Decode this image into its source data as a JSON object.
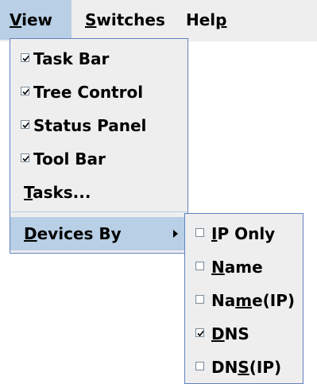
{
  "menubar": {
    "items": [
      {
        "mnemonic": "V",
        "rest": "iew"
      },
      {
        "mnemonic": "S",
        "rest": "witches"
      },
      {
        "pre": "Hel",
        "mnemonic": "p"
      }
    ]
  },
  "view_menu": {
    "items": [
      {
        "label": "Task Bar",
        "checked": true
      },
      {
        "label": "Tree Control",
        "checked": true
      },
      {
        "label": "Status Panel",
        "checked": true
      },
      {
        "label": "Tool Bar",
        "checked": true
      }
    ],
    "tasks": {
      "mnemonic": "T",
      "rest": "asks..."
    },
    "devices_by": {
      "mnemonic": "D",
      "rest": "evices By"
    }
  },
  "devices_submenu": {
    "items": [
      {
        "pre": "",
        "mnemonic": "I",
        "rest": "P Only",
        "checked": false
      },
      {
        "pre": "",
        "mnemonic": "N",
        "rest": "ame",
        "checked": false
      },
      {
        "pre": "Na",
        "mnemonic": "m",
        "rest": "e(IP)",
        "checked": false
      },
      {
        "pre": "",
        "mnemonic": "D",
        "rest": "NS",
        "checked": true
      },
      {
        "pre": "DN",
        "mnemonic": "S",
        "rest": "(IP)",
        "checked": false
      }
    ]
  },
  "colors": {
    "menu_bg": "#eeeeee",
    "highlight": "#b8cfe5",
    "popup_border": "#6382bf"
  }
}
